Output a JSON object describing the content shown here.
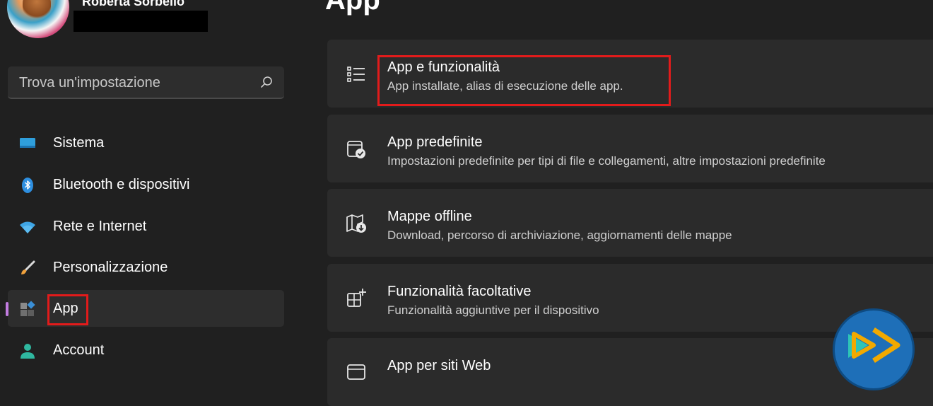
{
  "user": {
    "name": "Roberta Sorbello"
  },
  "search": {
    "placeholder": "Trova un'impostazione"
  },
  "sidebar": {
    "items": [
      {
        "label": "Sistema",
        "icon": "system-icon"
      },
      {
        "label": "Bluetooth e dispositivi",
        "icon": "bluetooth-icon"
      },
      {
        "label": "Rete e Internet",
        "icon": "wifi-icon"
      },
      {
        "label": "Personalizzazione",
        "icon": "brush-icon"
      },
      {
        "label": "App",
        "icon": "apps-icon",
        "selected": true
      },
      {
        "label": "Account",
        "icon": "account-icon"
      }
    ]
  },
  "main": {
    "title": "App",
    "cards": [
      {
        "title": "App e funzionalità",
        "subtitle": "App installate, alias di esecuzione delle app.",
        "icon": "list-icon"
      },
      {
        "title": "App predefinite",
        "subtitle": "Impostazioni predefinite per tipi di file e collegamenti, altre impostazioni predefinite",
        "icon": "default-apps-icon"
      },
      {
        "title": "Mappe offline",
        "subtitle": "Download, percorso di archiviazione, aggiornamenti delle mappe",
        "icon": "map-download-icon"
      },
      {
        "title": "Funzionalità facoltative",
        "subtitle": "Funzionalità aggiuntive per il dispositivo",
        "icon": "add-features-icon"
      },
      {
        "title": "App per siti Web",
        "subtitle": "",
        "icon": "web-apps-icon"
      }
    ]
  },
  "colors": {
    "background": "#202020",
    "card": "#2b2b2b",
    "accent": "#c27ce0",
    "highlight": "#e21b1b"
  }
}
